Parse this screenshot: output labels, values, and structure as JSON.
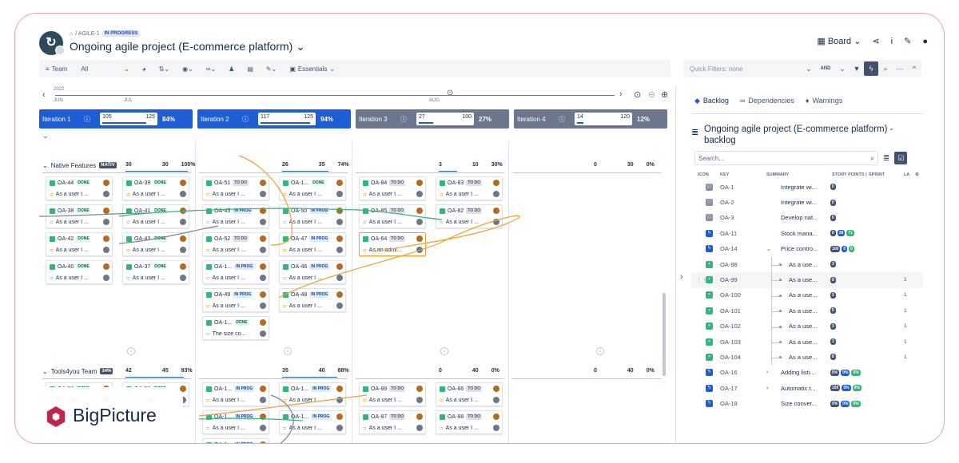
{
  "header": {
    "breadcrumb_prefix": "/ AGILE-1",
    "status": "IN PROGRESS",
    "title": "Ongoing agile project (E-commerce platform)",
    "board_label": "Board"
  },
  "toolbar": {
    "team_label": "Team",
    "team_value": "All",
    "essentials_label": "Essentials"
  },
  "quick_filters": {
    "placeholder": "Quick Filters: none",
    "and_label": "AND"
  },
  "timeline": {
    "year": "2022",
    "months": [
      "JUN",
      "JUL",
      "AUG"
    ]
  },
  "iterations": [
    {
      "name": "Iteration 1",
      "done": "105",
      "total": "125",
      "pct": "84%",
      "fill": 0.84,
      "color": "blue"
    },
    {
      "name": "Iteration 2",
      "done": "117",
      "total": "125",
      "pct": "94%",
      "fill": 0.94,
      "color": "blue"
    },
    {
      "name": "Iteration 3",
      "done": "27",
      "total": "100",
      "pct": "27%",
      "fill": 0.27,
      "color": "gray"
    },
    {
      "name": "Iteration 4",
      "done": "14",
      "total": "120",
      "pct": "12%",
      "fill": 0.12,
      "color": "gray"
    }
  ],
  "lanes": [
    {
      "name": "Native Features",
      "tag": "NATIV",
      "caps": [
        {
          "a": "30",
          "b": "30",
          "pct": "100%"
        },
        {
          "a": "26",
          "b": "35",
          "pct": "74%"
        },
        {
          "a": "3",
          "b": "10",
          "pct": "30%"
        },
        {
          "a": "0",
          "b": "30",
          "pct": "0%"
        }
      ]
    },
    {
      "name": "Tools4you Team",
      "tag": "34%",
      "caps": [
        {
          "a": "42",
          "b": "45",
          "pct": "93%"
        },
        {
          "a": "35",
          "b": "40",
          "pct": "88%"
        },
        {
          "a": "0",
          "b": "40",
          "pct": "0%"
        },
        {
          "a": "0",
          "b": "40",
          "pct": "0%"
        }
      ]
    }
  ],
  "cards": [
    {
      "key": "OA-44",
      "status": "DONE",
      "text": "As a user I ..."
    },
    {
      "key": "OA-39",
      "status": "DONE",
      "text": "As a user I ..."
    },
    {
      "key": "OA-38",
      "status": "DONE",
      "text": "As a user I ..."
    },
    {
      "key": "OA-41",
      "status": "DONE",
      "text": "As a user I ..."
    },
    {
      "key": "OA-42",
      "status": "DONE",
      "text": "As a user I ..."
    },
    {
      "key": "OA-43",
      "status": "DONE",
      "text": "As a user I ..."
    },
    {
      "key": "OA-40",
      "status": "DONE",
      "text": "As a user I ..."
    },
    {
      "key": "OA-37",
      "status": "DONE",
      "text": "As a user I ..."
    },
    {
      "key": "OA-51",
      "status": "TO DO",
      "text": "As a user I ..."
    },
    {
      "key": "OA-1...",
      "status": "DONE",
      "text": "As a user I ..."
    },
    {
      "key": "OA-45",
      "status": "IN PROG",
      "text": "As a user I ..."
    },
    {
      "key": "OA-50",
      "status": "IN PROG",
      "text": "As a user I ..."
    },
    {
      "key": "OA-52",
      "status": "TO DO",
      "text": "As a user I ..."
    },
    {
      "key": "OA-47",
      "status": "IN PROG",
      "text": "As a user I ..."
    },
    {
      "key": "OA-1...",
      "status": "IN PROG",
      "text": "As a user I ..."
    },
    {
      "key": "OA-46",
      "status": "IN PROG",
      "text": "As a user I ..."
    },
    {
      "key": "OA-49",
      "status": "IN PROG",
      "text": "As a user I ..."
    },
    {
      "key": "OA-48",
      "status": "IN PROG",
      "text": "As a user I ..."
    },
    {
      "key": "OA-1...",
      "status": "DONE",
      "text": "The size co..."
    },
    {
      "key": "OA-84",
      "status": "TO DO",
      "text": "As a user I ..."
    },
    {
      "key": "OA-83",
      "status": "TO DO",
      "text": "As a user I ..."
    },
    {
      "key": "OA-85",
      "status": "TO DO",
      "text": "As a user I ..."
    },
    {
      "key": "OA-82",
      "status": "TO DO",
      "text": "As a user I ..."
    },
    {
      "key": "OA-64",
      "status": "TO DO",
      "text": "As an admi..."
    },
    {
      "key": "OA-58",
      "status": "DONE",
      "text": "As a user I ..."
    },
    {
      "key": "OA-56",
      "status": "DONE",
      "text": "As a user I ..."
    },
    {
      "key": "OA-1...",
      "status": "IN PROG",
      "text": "As a user I ..."
    },
    {
      "key": "OA-1...",
      "status": "IN PROG",
      "text": "As a user I ..."
    },
    {
      "key": "OA-1...",
      "status": "IN PROG",
      "text": "As a user I ..."
    },
    {
      "key": "OA-1...",
      "status": "IN PROG",
      "text": "As a user I ..."
    },
    {
      "key": "OA-1...",
      "status": "IN PROG",
      "text": "As a user I ..."
    },
    {
      "key": "OA-89",
      "status": "TO DO",
      "text": "As a user I ..."
    },
    {
      "key": "OA-86",
      "status": "TO DO",
      "text": "As a user I ..."
    },
    {
      "key": "OA-87",
      "status": "TO DO",
      "text": "As a user I ..."
    },
    {
      "key": "OA-88",
      "status": "TO DO",
      "text": "As a user I ..."
    }
  ],
  "right_panel": {
    "tabs": [
      "Backlog",
      "Dependencies",
      "Warnings"
    ],
    "title": "Ongoing agile project (E-commerce platform) - backlog",
    "search_placeholder": "Search...",
    "columns": [
      "ICON",
      "KEY",
      "SUMMARY",
      "STORY POINTS |",
      "SPRINT",
      "LA"
    ],
    "rows": [
      {
        "key": "OA-1",
        "summary": "Integrate wi...",
        "type": "task",
        "points": [
          "0"
        ],
        "la": ""
      },
      {
        "key": "OA-2",
        "summary": "Integrate wi...",
        "type": "task",
        "points": [
          "0"
        ],
        "la": ""
      },
      {
        "key": "OA-3",
        "summary": "Develop nat...",
        "type": "task",
        "points": [
          "0"
        ],
        "la": ""
      },
      {
        "key": "OA-11",
        "summary": "Stock mana...",
        "type": "epic",
        "points": [
          "0",
          "28",
          "71"
        ],
        "la": ""
      },
      {
        "key": "OA-14",
        "summary": "Price contro...",
        "type": "epic",
        "points": [
          "100",
          "0",
          "0"
        ],
        "la": "",
        "expanded": true
      },
      {
        "key": "OA-98",
        "summary": "As a use...",
        "type": "story",
        "points": [
          "3"
        ],
        "la": "",
        "child": true
      },
      {
        "key": "OA-99",
        "summary": "As a use...",
        "type": "story",
        "points": [
          "8"
        ],
        "la": "1",
        "child": true,
        "highlight": true
      },
      {
        "key": "OA-100",
        "summary": "As a use...",
        "type": "story",
        "points": [
          "3"
        ],
        "la": "1",
        "child": true
      },
      {
        "key": "OA-101",
        "summary": "As a use...",
        "type": "story",
        "points": [
          "5"
        ],
        "la": "1",
        "child": true
      },
      {
        "key": "OA-102",
        "summary": "As a use...",
        "type": "story",
        "points": [
          "3"
        ],
        "la": "1",
        "child": true
      },
      {
        "key": "OA-103",
        "summary": "As a use...",
        "type": "story",
        "points": [
          "3"
        ],
        "la": "1",
        "child": true
      },
      {
        "key": "OA-104",
        "summary": "As a use...",
        "type": "story",
        "points": [
          "8"
        ],
        "la": "1",
        "child": true
      },
      {
        "key": "OA-16",
        "summary": "Adding listi...",
        "type": "epic",
        "points": [
          "0%",
          "0%",
          "0%"
        ],
        "la": "",
        "collapsed": true
      },
      {
        "key": "OA-17",
        "summary": "Automatic t...",
        "type": "epic",
        "points": [
          "100",
          "0%",
          "0%"
        ],
        "la": "",
        "collapsed": true
      },
      {
        "key": "OA-18",
        "summary": "Size conver...",
        "type": "epic",
        "points": [
          "0%",
          "0%",
          "0%"
        ],
        "la": ""
      }
    ]
  },
  "brand": {
    "name": "BigPicture",
    "color": "#c3244d"
  }
}
